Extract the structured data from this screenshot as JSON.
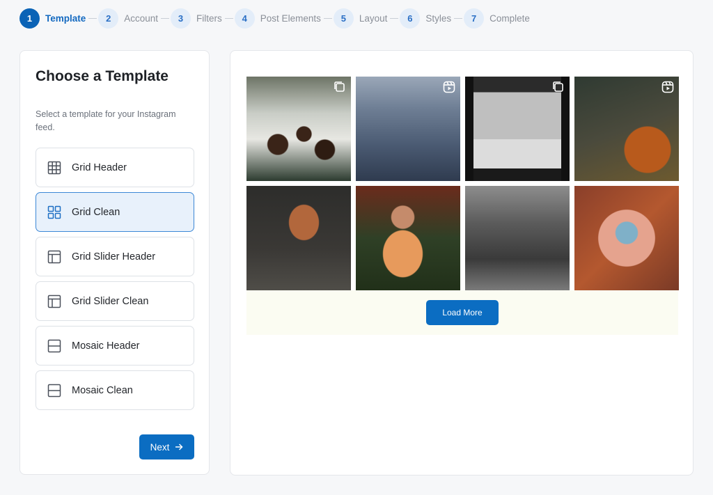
{
  "steps": [
    {
      "num": "1",
      "label": "Template"
    },
    {
      "num": "2",
      "label": "Account"
    },
    {
      "num": "3",
      "label": "Filters"
    },
    {
      "num": "4",
      "label": "Post Elements"
    },
    {
      "num": "5",
      "label": "Layout"
    },
    {
      "num": "6",
      "label": "Styles"
    },
    {
      "num": "7",
      "label": "Complete"
    }
  ],
  "active_step": "Template",
  "left": {
    "title": "Choose a Template",
    "subtitle": "Select a template for your Instagram feed.",
    "templates": [
      {
        "label": "Grid Header",
        "icon": "grid-9-icon"
      },
      {
        "label": "Grid Clean",
        "icon": "grid-4-icon"
      },
      {
        "label": "Grid Slider Header",
        "icon": "layout-sidebar-icon"
      },
      {
        "label": "Grid Slider Clean",
        "icon": "layout-sidebar-icon"
      },
      {
        "label": "Mosaic Header",
        "icon": "rows-icon"
      },
      {
        "label": "Mosaic Clean",
        "icon": "rows-icon"
      }
    ],
    "selected_template": "Grid Clean",
    "next_label": "Next"
  },
  "preview": {
    "load_more_label": "Load More",
    "colors": {
      "accent": "#0b6dc2",
      "selected_bg": "#e8f1fb",
      "load_area_bg": "#fbfcf2"
    }
  }
}
